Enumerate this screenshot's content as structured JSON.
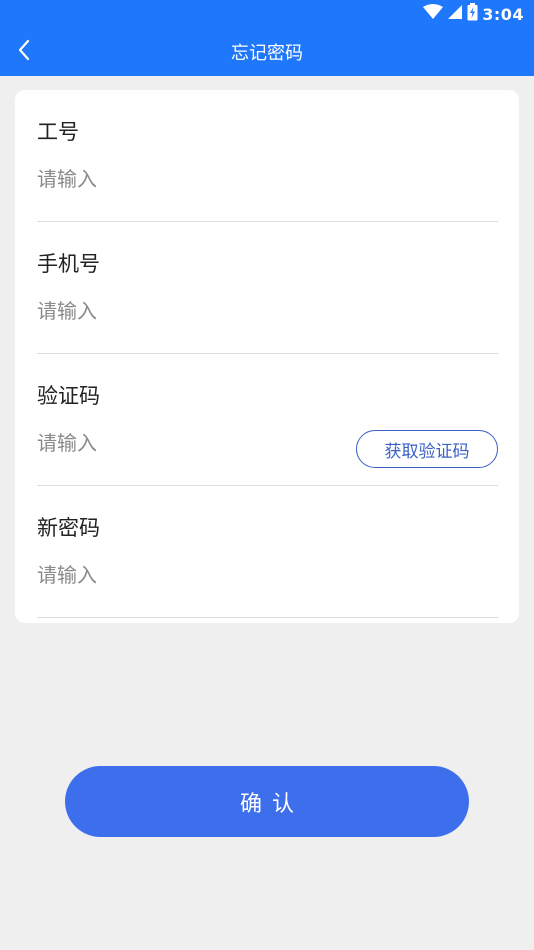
{
  "status_bar": {
    "time": "3:04",
    "icons": [
      "wifi-icon",
      "signal-icon",
      "battery-charging-icon"
    ]
  },
  "header": {
    "title": "忘记密码",
    "back_icon": "chevron-left-icon"
  },
  "colors": {
    "header_bg": "#1f77fb",
    "page_bg": "#efefef",
    "card_bg": "#ffffff",
    "primary_button": "#3d6fec",
    "outline_button": "#3a5fc5",
    "placeholder_text": "#8a8a8a"
  },
  "form": {
    "employee_id": {
      "label": "工号",
      "placeholder": "请输入",
      "value": ""
    },
    "phone": {
      "label": "手机号",
      "placeholder": "请输入",
      "value": ""
    },
    "verification_code": {
      "label": "验证码",
      "placeholder": "请输入",
      "value": "",
      "send_code_label": "获取验证码"
    },
    "new_password": {
      "label": "新密码",
      "placeholder": "请输入",
      "value": ""
    }
  },
  "confirm_label": "确认"
}
